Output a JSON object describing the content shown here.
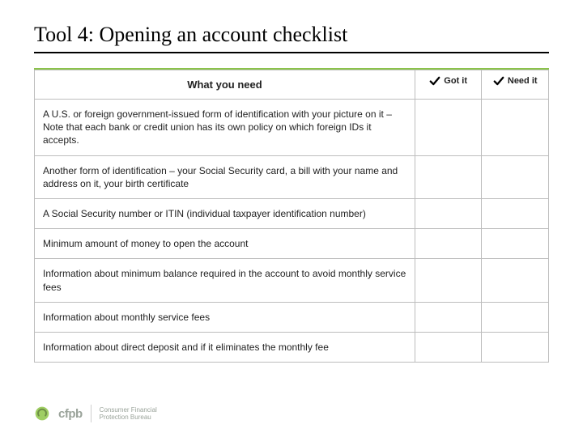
{
  "title": "Tool 4: Opening an account checklist",
  "table": {
    "header": {
      "what": "What you need",
      "got": "Got it",
      "need": "Need it"
    },
    "rows": [
      "A U.S. or foreign government-issued form of identification with your picture on it – Note that each bank or credit union has its own policy on which foreign IDs it accepts.",
      "Another form of identification – your Social Security card, a bill with your name and address on it, your birth certificate",
      "A Social Security number or ITIN (individual taxpayer identification number)",
      "Minimum amount of money to open the account",
      "Information about minimum balance required in the account to avoid monthly service fees",
      "Information about monthly service fees",
      "Information about direct deposit and if it eliminates the monthly fee"
    ]
  },
  "footer": {
    "wordmark": "cfpb",
    "line1": "Consumer Financial",
    "line2": "Protection Bureau"
  },
  "icons": {
    "check": "check-icon",
    "logo": "cfpb-logo-icon"
  }
}
